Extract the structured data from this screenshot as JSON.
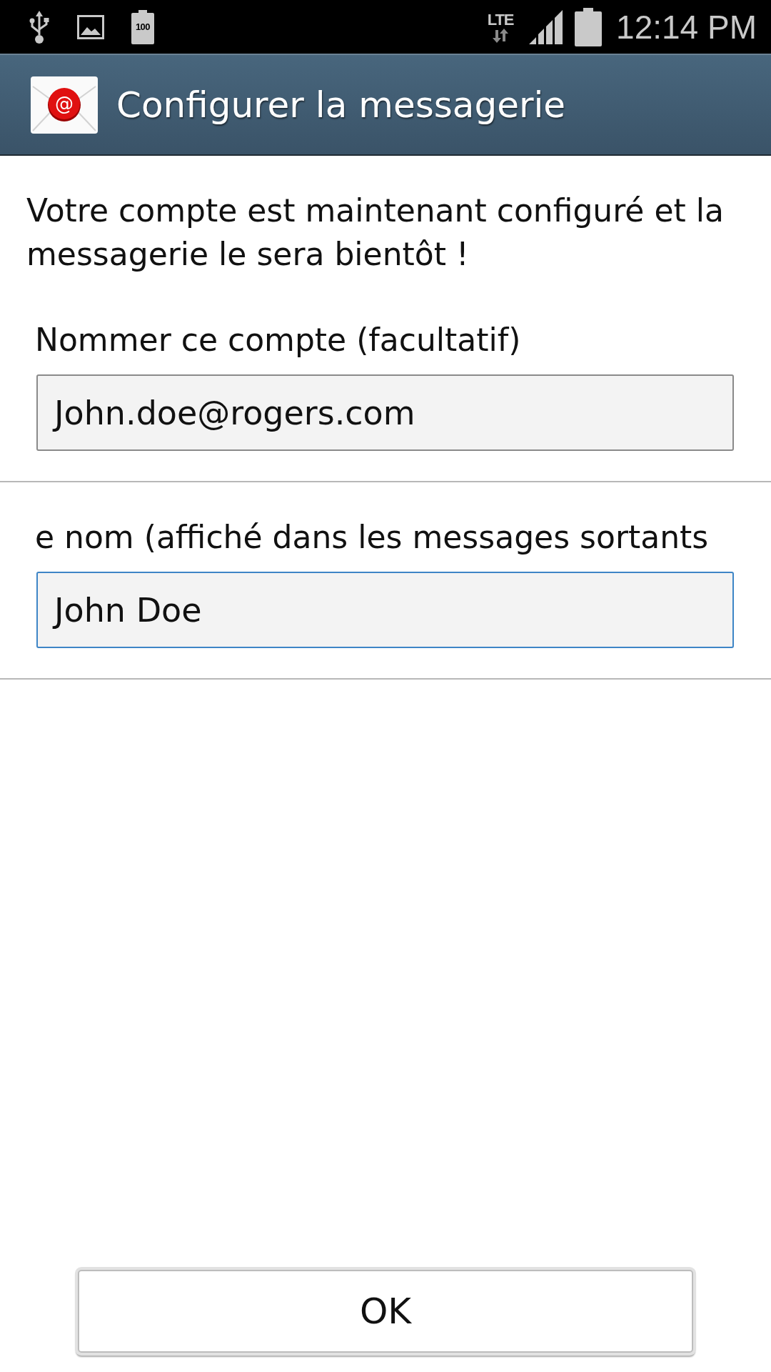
{
  "status_bar": {
    "battery_notice": "100",
    "network": "LTE",
    "time": "12:14 PM"
  },
  "app_bar": {
    "logo_mark": "@",
    "title": "Configurer la messagerie"
  },
  "message": "Votre compte est maintenant configuré et la messagerie le sera bientôt !",
  "fields": [
    {
      "label": "Nommer ce compte (facultatif)",
      "value": "John.doe@rogers.com",
      "focused": false
    },
    {
      "label": "e nom (affiché dans les messages sortants",
      "value": "John Doe",
      "focused": true
    }
  ],
  "buttons": [
    {
      "label": "OK"
    }
  ]
}
